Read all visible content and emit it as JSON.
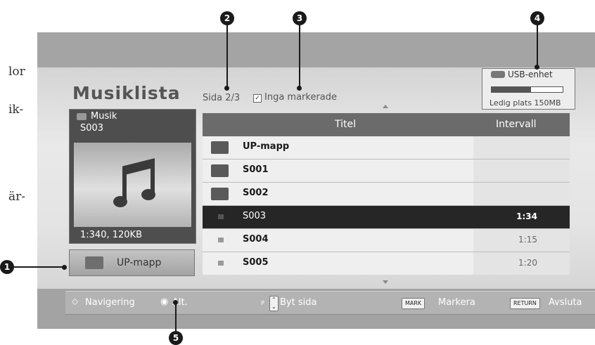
{
  "margin_text": [
    "lor",
    "ik-",
    "är-"
  ],
  "callouts": [
    "1",
    "2",
    "3",
    "4",
    "5"
  ],
  "screen": {
    "title": "Musiklista",
    "page_indicator": "Sida 2/3",
    "selection_status": "Inga markerade",
    "usb": {
      "label": "USB-enhet",
      "free_space": "Ledig plats 150MB",
      "used_fraction": 0.55
    },
    "left_panel": {
      "category": "Musik",
      "current_file": "S003",
      "file_info": "1:340, 120KB",
      "up_button": "UP-mapp"
    },
    "list": {
      "headers": {
        "title": "Titel",
        "interval": "Intervall"
      },
      "rows": [
        {
          "name": "UP-mapp",
          "type": "folder",
          "duration": "",
          "selected": false
        },
        {
          "name": "S001",
          "type": "folder",
          "duration": "",
          "selected": false
        },
        {
          "name": "S002",
          "type": "folder",
          "duration": "",
          "selected": false
        },
        {
          "name": "S003",
          "type": "music",
          "duration": "1:34",
          "selected": true
        },
        {
          "name": "S004",
          "type": "music",
          "duration": "1:15",
          "selected": false
        },
        {
          "name": "S005",
          "type": "music",
          "duration": "1:20",
          "selected": false
        }
      ]
    },
    "footer": {
      "navigate": "Navigering",
      "options": "Alt.",
      "page_key": "P",
      "page_change": "Byt sida",
      "mark_key": "MARK",
      "mark": "Markera",
      "return_key": "RETURN",
      "exit": "Avsluta"
    }
  }
}
